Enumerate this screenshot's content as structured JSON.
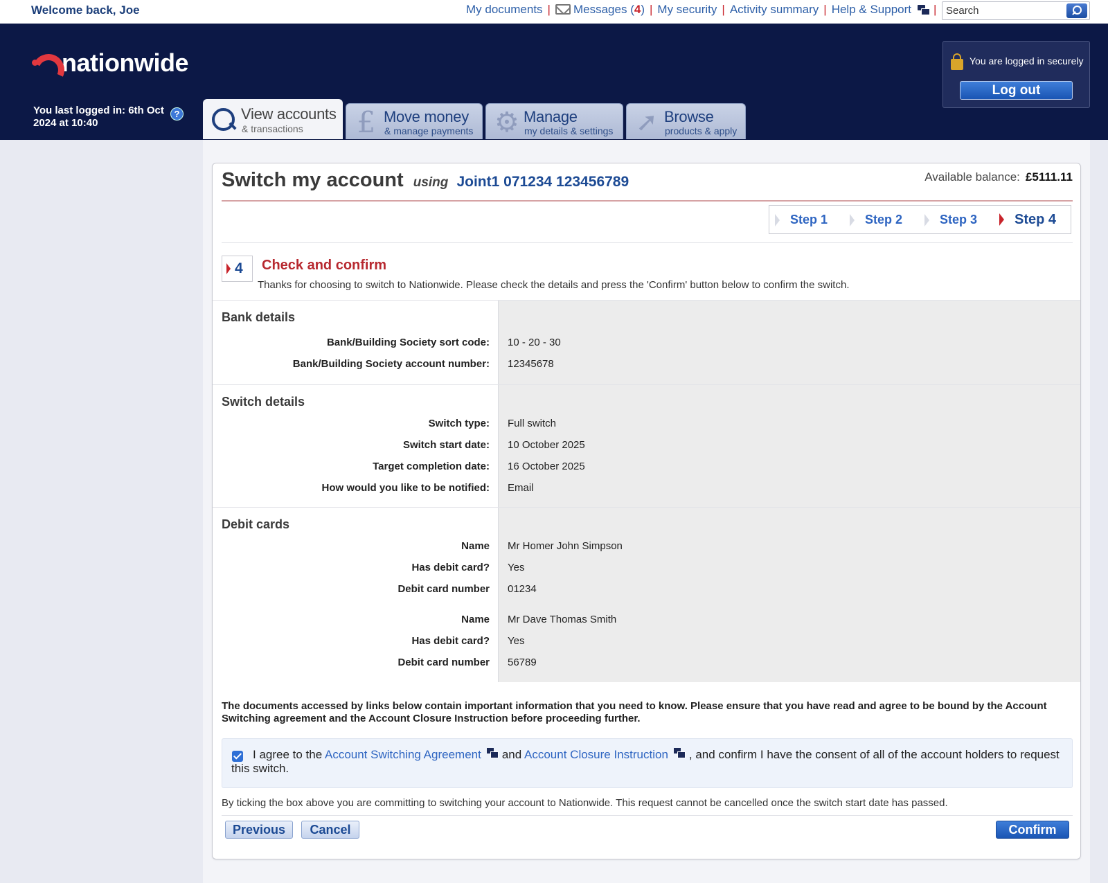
{
  "topbar": {
    "welcome": "Welcome back, Joe",
    "links": {
      "documents": "My documents",
      "messages": "Messages",
      "messages_open": "(",
      "messages_count": "4",
      "messages_close": ")",
      "security": "My security",
      "activity": "Activity summary",
      "help": "Help & Support"
    },
    "search_placeholder": "Search"
  },
  "header": {
    "logo": "nationwide",
    "last_logged": "You last logged in: 6th Oct 2024 at 10:40",
    "help_icon": "?",
    "secure_text": "You are logged in securely",
    "logout_label": "Log out"
  },
  "tabs": [
    {
      "title": "View accounts",
      "sub": "& transactions",
      "icon": "search-icon",
      "active": true
    },
    {
      "title": "Move money",
      "sub": "& manage payments",
      "icon": "pound-icon",
      "active": false
    },
    {
      "title": "Manage",
      "sub": "my details & settings",
      "icon": "gear-icon",
      "active": false
    },
    {
      "title": "Browse",
      "sub": "products & apply",
      "icon": "cursor-arrow-icon",
      "active": false
    }
  ],
  "page": {
    "title": "Switch my account",
    "using": "using",
    "account": "Joint1 071234 123456789",
    "available_label": "Available balance:",
    "available_value": "£5111.11",
    "steps": [
      "Step 1",
      "Step 2",
      "Step 3",
      "Step 4"
    ],
    "current_step": 4,
    "step_badge": "4",
    "section_title": "Check and confirm",
    "intro": "Thanks for choosing to switch to Nationwide. Please check the details and press the 'Confirm' button below to confirm the switch."
  },
  "bank_details": {
    "title": "Bank details",
    "rows": [
      {
        "label": "Bank/Building Society sort code:",
        "value": "10 - 20 - 30"
      },
      {
        "label": "Bank/Building Society account number:",
        "value": "12345678"
      }
    ]
  },
  "switch_details": {
    "title": "Switch details",
    "rows": [
      {
        "label": "Switch type:",
        "value": "Full switch"
      },
      {
        "label": "Switch start date:",
        "value": "10 October 2025"
      },
      {
        "label": "Target completion date:",
        "value": "16 October 2025"
      },
      {
        "label": "How would you like to be notified:",
        "value": "Email"
      }
    ]
  },
  "debit_cards": {
    "title": "Debit cards",
    "rows": [
      {
        "label": "Name",
        "value": "Mr Homer John Simpson"
      },
      {
        "label": "Has debit card?",
        "value": "Yes"
      },
      {
        "label": "Debit card number",
        "value": "01234"
      },
      {
        "label": "Name",
        "value": "Mr Dave Thomas Smith"
      },
      {
        "label": "Has debit card?",
        "value": "Yes"
      },
      {
        "label": "Debit card number",
        "value": "56789"
      }
    ]
  },
  "agreement": {
    "legal": "The documents accessed by links below contain important information that you need to know. Please ensure that you have read and agree to be bound by the Account Switching agreement and the Account Closure Instruction before proceeding further.",
    "prefix": "I agree to the",
    "link1": "Account Switching Agreement",
    "middle": "and",
    "link2": "Account Closure Instruction",
    "suffix": ", and confirm I have the consent of all of the account holders to request this switch.",
    "checked": true,
    "commit_note": "By ticking the box above you are committing to switching your account to Nationwide. This request cannot be cancelled once the switch start date has passed."
  },
  "buttons": {
    "previous": "Previous",
    "cancel": "Cancel",
    "confirm": "Confirm"
  },
  "colors": {
    "navy": "#0c1846",
    "brand_red": "#e2383f",
    "link_blue": "#2d64c1",
    "heading_red": "#b7282f"
  }
}
